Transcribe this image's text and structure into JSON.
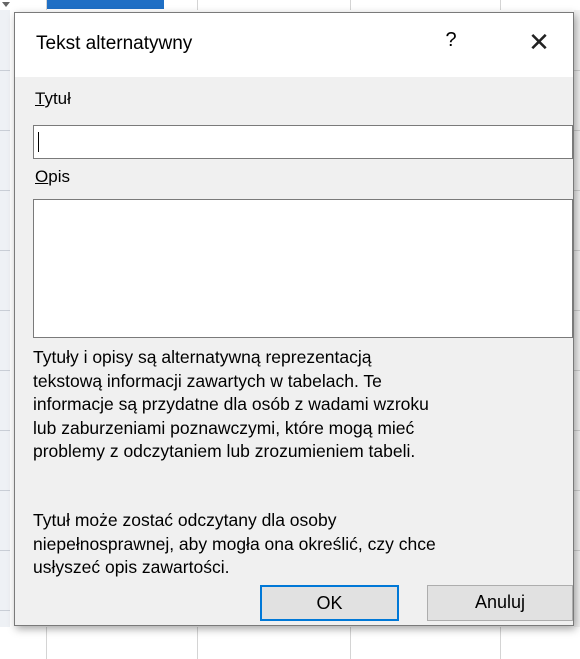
{
  "dialog": {
    "title": "Tekst alternatywny",
    "help_glyph": "?",
    "close_glyph": "✕",
    "title_field": {
      "label_access_key": "T",
      "label_rest": "ytuł",
      "value": ""
    },
    "description_field": {
      "label_access_key": "O",
      "label_rest": "pis",
      "value": ""
    },
    "help_paragraph_1": "Tytuły i opisy są alternatywną reprezentacją\ntekstową informacji zawartych w tabelach. Te\ninformacje są przydatne dla osób z wadami wzroku\nlub zaburzeniami poznawczymi, które mogą mieć\nproblemy z odczytaniem lub zrozumieniem tabeli.",
    "help_paragraph_2": "Tytuł może zostać odczytany dla osoby\nniepełnosprawnej, aby mogła ona określić, czy chce\nusłyszeć opis zawartości.",
    "ok_label": "OK",
    "cancel_label": "Anuluj"
  }
}
